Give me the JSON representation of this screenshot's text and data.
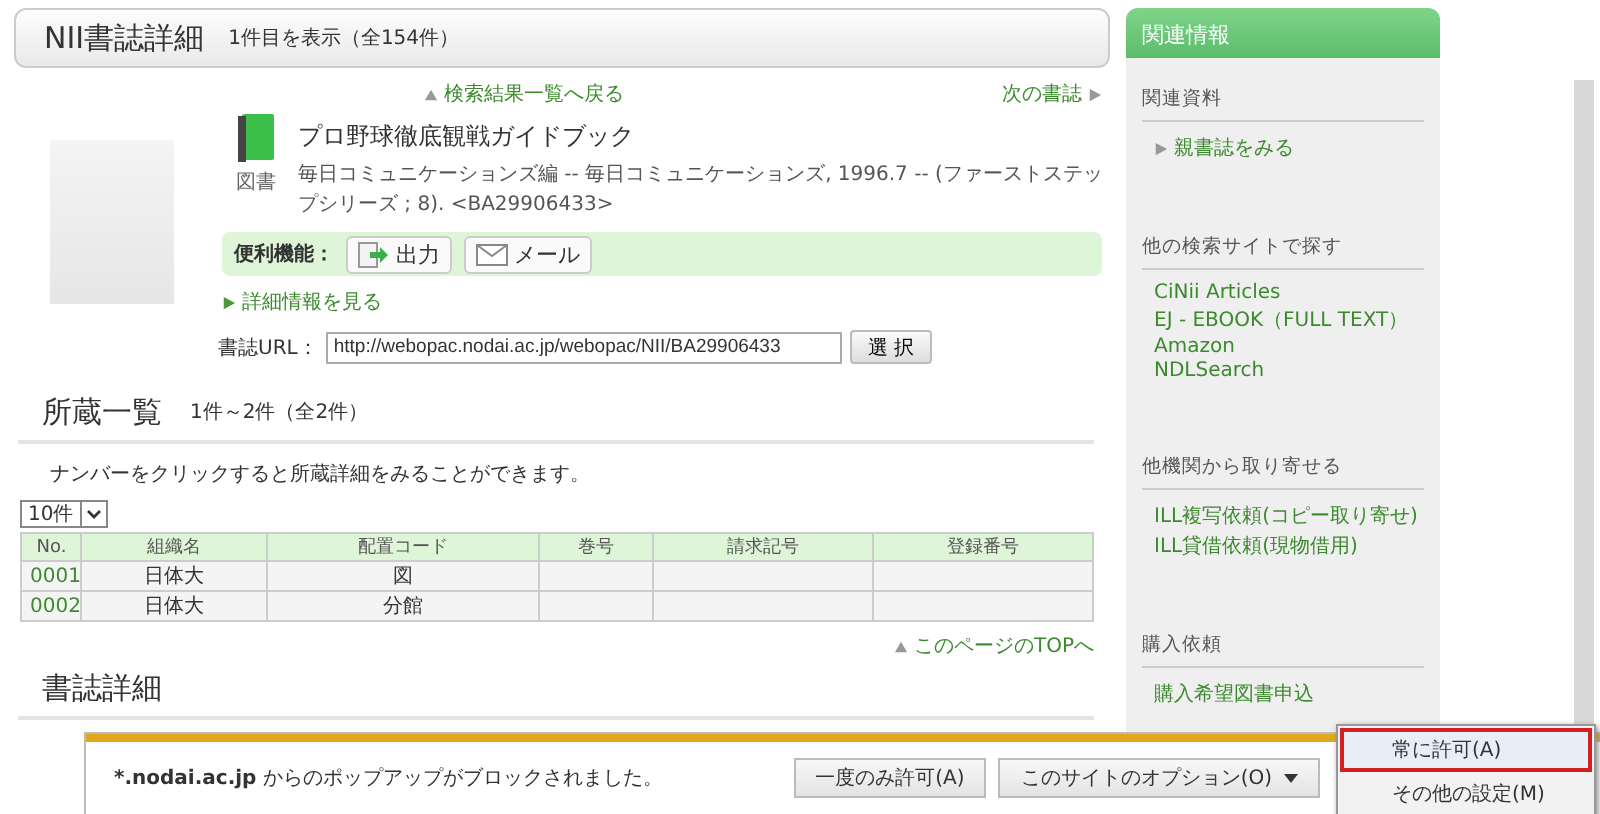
{
  "header": {
    "title": "NII書誌詳細",
    "count": "1件目を表示（全154件）"
  },
  "nav": {
    "back": "検索結果一覧へ戻る",
    "next": "次の書誌"
  },
  "record": {
    "type_label": "図書",
    "title": "プロ野球徹底観戦ガイドブック",
    "description": "毎日コミュニケーションズ編 -- 毎日コミュニケーションズ, 1996.7 -- (ファーストステップシリーズ ; 8). <BA29906433>"
  },
  "tools": {
    "label": "便利機能：",
    "buttons": [
      {
        "label": "出力",
        "kind": "export"
      },
      {
        "label": "メール",
        "kind": "mail"
      }
    ]
  },
  "details_link": "詳細情報を見る",
  "url": {
    "label": "書誌URL：",
    "value": "http://webopac.nodai.ac.jp/webopac/NII/BA29906433",
    "button": "選 択"
  },
  "holdings": {
    "title": "所蔵一覧",
    "count": "1件～2件（全2件）",
    "note": "ナンバーをクリックすると所蔵詳細をみることができます。",
    "page_size": "10件",
    "columns": [
      "No.",
      "組織名",
      "配置コード",
      "巻号",
      "請求記号",
      "登録番号"
    ],
    "rows": [
      {
        "no": "0001",
        "organization": "日体大",
        "location": "図"
      },
      {
        "no": "0002",
        "organization": "日体大",
        "location": "分館"
      }
    ],
    "top_link": "このページのTOPへ"
  },
  "bibliography": {
    "title": "書誌詳細"
  },
  "sidebar": {
    "title": "関連情報",
    "sections": [
      {
        "heading": "関連資料",
        "links": [
          {
            "label": "親書誌をみる",
            "kind": "arrow"
          }
        ]
      },
      {
        "heading": "他の検索サイトで探す",
        "links": [
          {
            "label": "CiNii Articles",
            "kind": "plain"
          },
          {
            "label": "EJ - EBOOK（FULL TEXT）",
            "kind": "plain"
          },
          {
            "label": "Amazon",
            "kind": "plain"
          },
          {
            "label": "NDLSearch",
            "kind": "plain"
          }
        ]
      },
      {
        "heading": "他機関から取り寄せる",
        "links": [
          {
            "label": "ILL複写依頼(コピー取り寄せ)",
            "kind": "plain"
          },
          {
            "label": "ILL貸借依頼(現物借用)",
            "kind": "plain"
          }
        ]
      },
      {
        "heading": "購入依頼",
        "links": [
          {
            "label": "購入希望図書申込",
            "kind": "plain"
          }
        ]
      }
    ]
  },
  "popup_bar": {
    "domain": "*.nodai.ac.jp",
    "message": "からのポップアップがブロックされました。",
    "buttons": [
      {
        "label": "一度のみ許可(A)",
        "kind": "plain"
      },
      {
        "label": "このサイトのオプション(O)",
        "kind": "dropdown"
      }
    ]
  },
  "popup_menu": {
    "items": [
      {
        "label": "常に許可(A)",
        "selected": true
      },
      {
        "label": "その他の設定(M)",
        "selected": false
      }
    ]
  }
}
